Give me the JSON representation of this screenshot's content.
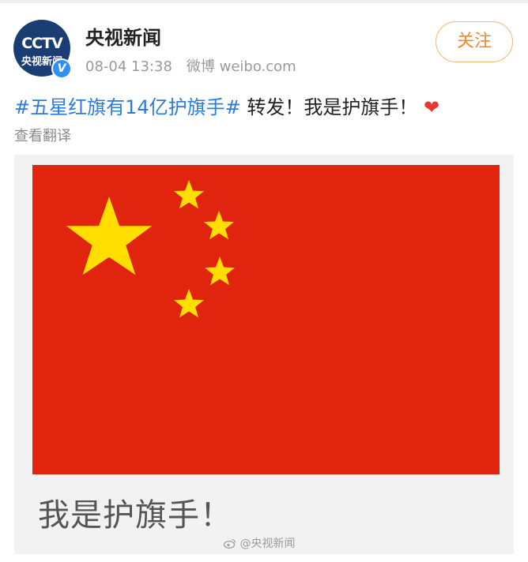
{
  "user": {
    "name": "央视新闻",
    "avatar_logo": "CCTV",
    "avatar_text": "央视新闻",
    "verified_mark": "V"
  },
  "meta": {
    "datetime": "08-04 13:38",
    "source": "微博 weibo.com"
  },
  "follow_label": "关注",
  "post": {
    "hashtag": "#五星红旗有14亿护旗手#",
    "text": " 转发！我是护旗手！",
    "emoji": "❤"
  },
  "translate_label": "查看翻译",
  "image": {
    "caption": "我是护旗手！",
    "watermark": "@央视新闻"
  },
  "colors": {
    "flag_red": "#e0240d",
    "star_yellow": "#ffde00",
    "accent_orange": "#f08a24",
    "link_blue": "#2b7cd8"
  }
}
